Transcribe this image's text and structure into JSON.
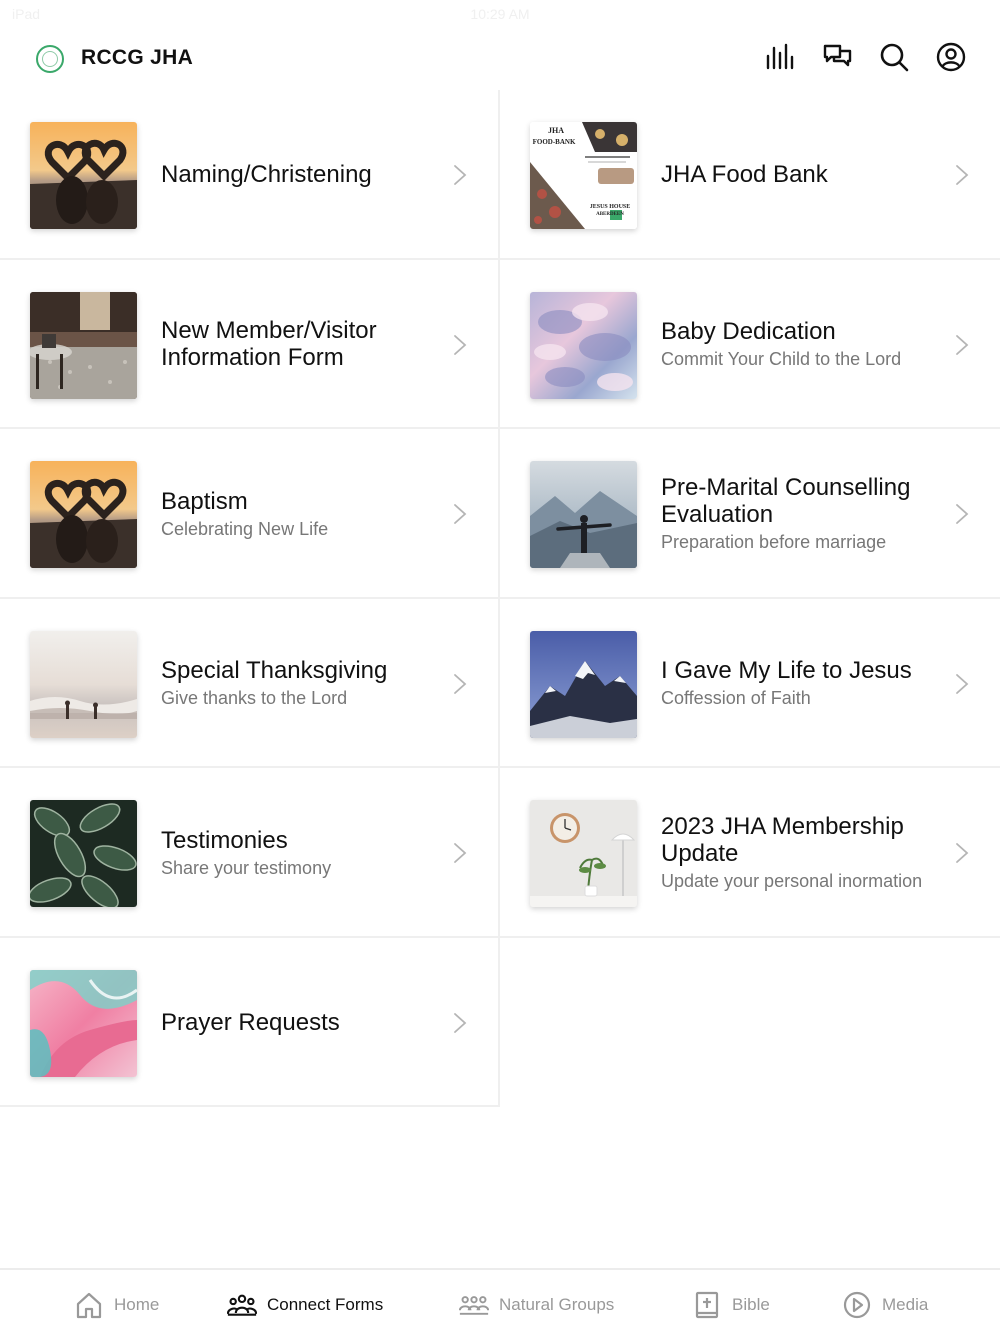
{
  "status": {
    "left": "iPad",
    "time": "10:29 AM"
  },
  "header": {
    "brand": "RCCG JHA",
    "icons": [
      "analytics-icon",
      "chat-icon",
      "search-icon",
      "profile-icon"
    ]
  },
  "items": [
    {
      "title": "Naming/Christening",
      "subtitle": "",
      "thumb": "sunset-hearts"
    },
    {
      "title": "JHA Food Bank",
      "subtitle": "",
      "thumb": "food-bank-flyer"
    },
    {
      "title": "New Member/Visitor Information Form",
      "subtitle": "",
      "thumb": "living-room"
    },
    {
      "title": "Baby Dedication",
      "subtitle": "Commit Your Child to the Lord",
      "thumb": "pastel-clouds"
    },
    {
      "title": "Baptism",
      "subtitle": "Celebrating New Life",
      "thumb": "sunset-hearts"
    },
    {
      "title": "Pre-Marital Counselling Evaluation",
      "subtitle": "Preparation before marriage",
      "thumb": "mountain-man"
    },
    {
      "title": "Special Thanksgiving",
      "subtitle": "Give thanks to the Lord",
      "thumb": "beach-waves"
    },
    {
      "title": "I Gave My Life to Jesus",
      "subtitle": "Coffession of Faith",
      "thumb": "snowy-mountain"
    },
    {
      "title": "Testimonies",
      "subtitle": "Share your testimony",
      "thumb": "green-leaves"
    },
    {
      "title": "2023 JHA Membership Update",
      "subtitle": "Update your personal inormation",
      "thumb": "clock-plant"
    },
    {
      "title": "Prayer Requests",
      "subtitle": "",
      "thumb": "pink-marble"
    }
  ],
  "food_bank_flyer": {
    "top": "JHA",
    "label": "FOOD-BANK",
    "bottom1": "JESUS HOUSE",
    "bottom2": "ABERDEEN"
  },
  "tabs": [
    {
      "label": "Home",
      "icon": "home-icon",
      "active": false
    },
    {
      "label": "Connect Forms",
      "icon": "people-icon",
      "active": true
    },
    {
      "label": "Natural Groups",
      "icon": "group-icon",
      "active": false
    },
    {
      "label": "Bible",
      "icon": "bible-icon",
      "active": false
    },
    {
      "label": "Media",
      "icon": "play-icon",
      "active": false
    }
  ],
  "colors": {
    "accent": "#111111",
    "inactive": "#999999",
    "divider": "#efefef",
    "brand_ring": "#3aa86a"
  }
}
